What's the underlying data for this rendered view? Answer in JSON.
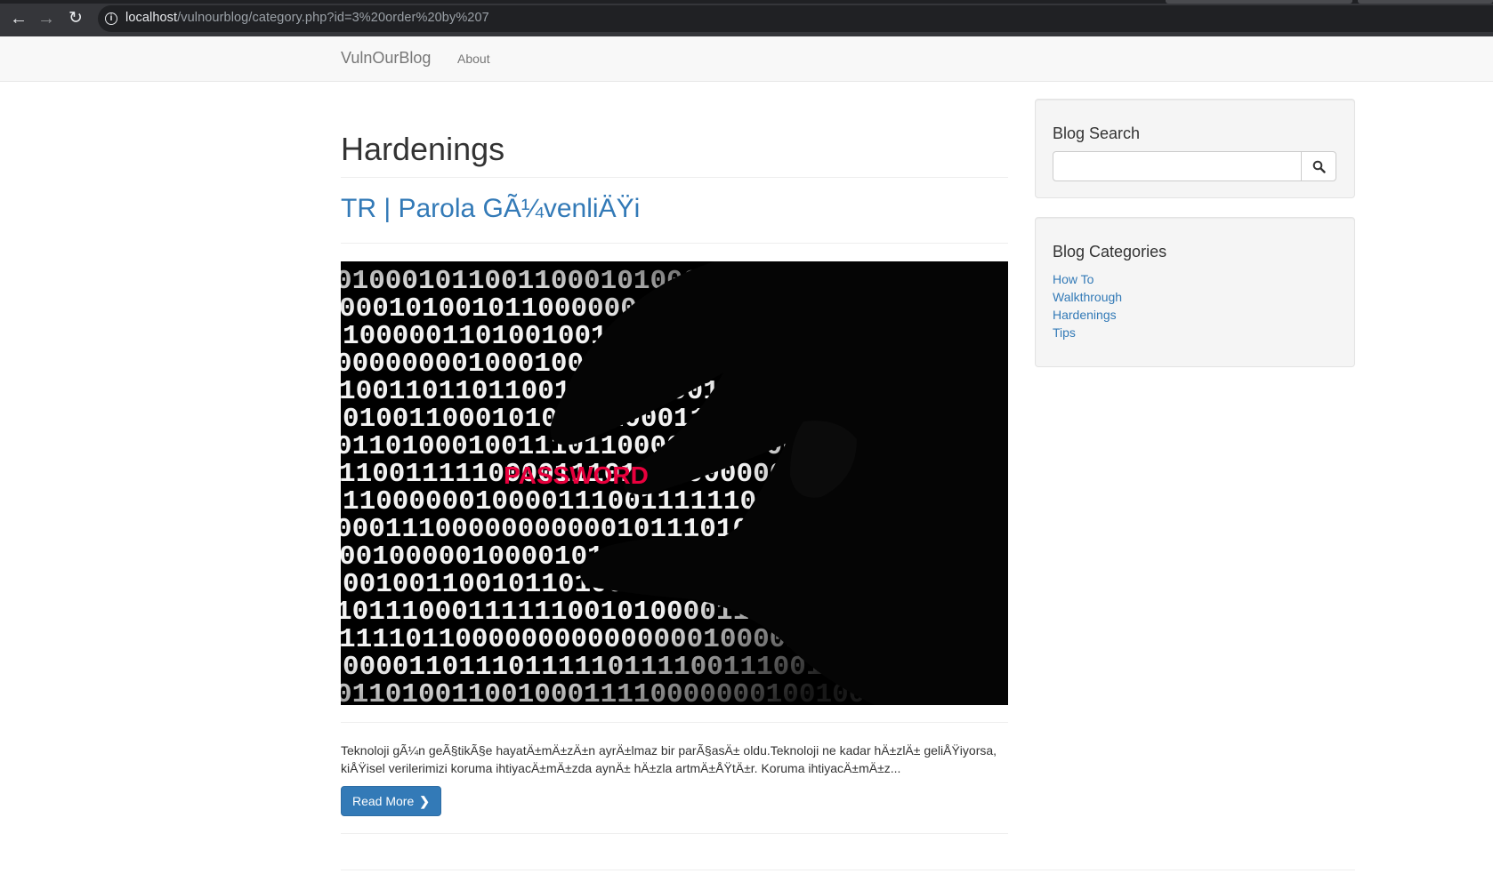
{
  "browser": {
    "url_host": "localhost",
    "url_path": "/vulnourblog/category.php?id=3%20order%20by%207"
  },
  "navbar": {
    "brand": "VulnOurBlog",
    "links": [
      "About"
    ]
  },
  "main": {
    "page_title": "Hardenings",
    "post": {
      "title": "TR | Parola GÃ¼venliÄŸi",
      "image_word": "PASSWORD",
      "excerpt": "Teknoloji gÃ¼n geÃ§tikÃ§e hayatÄ±mÄ±zÄ±n ayrÄ±lmaz bir parÃ§asÄ± oldu.Teknoloji ne kadar hÄ±zlÄ± geliÅŸiyorsa, kiÅŸisel verilerimizi koruma ihtiyacÄ±mÄ±zda aynÄ± hÄ±zla artmÄ±ÅŸtÄ±r. Koruma ihtiyacÄ±mÄ±z...",
      "read_more_label": "Read More"
    }
  },
  "sidebar": {
    "search": {
      "title": "Blog Search",
      "value": ""
    },
    "categories": {
      "title": "Blog Categories",
      "items": [
        "How To",
        "Walkthrough",
        "Hardenings",
        "Tips"
      ]
    }
  },
  "colors": {
    "link": "#337ab7",
    "button": "#337ab7",
    "image_highlight": "#e8003d"
  }
}
